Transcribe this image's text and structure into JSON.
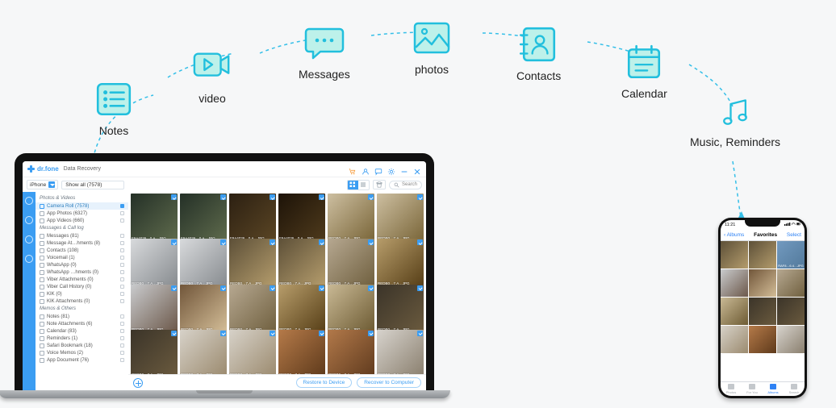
{
  "arc": {
    "notes": {
      "label": "Notes"
    },
    "video": {
      "label": "video"
    },
    "messages": {
      "label": "Messages"
    },
    "photos": {
      "label": "photos"
    },
    "contacts": {
      "label": "Contacts"
    },
    "calendar": {
      "label": "Calendar"
    },
    "music": {
      "label": "Music, Reminders"
    }
  },
  "app": {
    "brand": "dr.fone",
    "breadcrumb": "Data Recovery",
    "device": "iPhone",
    "filter": "Show all (7578)",
    "search_placeholder": "Search",
    "footer": {
      "restore": "Restore to Device",
      "recover": "Recover to Computer"
    }
  },
  "sidebar": {
    "sections": [
      {
        "title": "Photos & Videos",
        "items": [
          {
            "label": "Camera Roll (7578)",
            "active": true
          },
          {
            "label": "App Photos (6327)"
          },
          {
            "label": "App Videos (660)"
          }
        ]
      },
      {
        "title": "Messages & Call log",
        "items": [
          {
            "label": "Messages (81)"
          },
          {
            "label": "Message At…hments (8)"
          },
          {
            "label": "Contacts (108)"
          },
          {
            "label": "Voicemail (1)"
          },
          {
            "label": "WhatsApp (0)"
          },
          {
            "label": "WhatsApp …hments (0)"
          },
          {
            "label": "Viber Attachments (0)"
          },
          {
            "label": "Viber Call History (0)"
          },
          {
            "label": "KIK (0)"
          },
          {
            "label": "KIK Attachments (0)"
          }
        ]
      },
      {
        "title": "Memos & Others",
        "items": [
          {
            "label": "Notes (81)"
          },
          {
            "label": "Note Attachments (6)"
          },
          {
            "label": "Calendar (83)"
          },
          {
            "label": "Reminders (1)"
          },
          {
            "label": "Safari Bookmark (18)"
          },
          {
            "label": "Voice Memos (2)"
          },
          {
            "label": "App Document (76)"
          }
        ]
      }
    ]
  },
  "grid": {
    "items": [
      {
        "cap": "F9A4036…0.A…JPG",
        "c": "t1"
      },
      {
        "cap": "F9A4036…0.A…JPG",
        "c": "t1"
      },
      {
        "cap": "F9A4036…0.A…JPG",
        "c": "t2"
      },
      {
        "cap": "F9A4036…0.A…JPG",
        "c": "t3"
      },
      {
        "cap": "REDB0…7.A…JPG",
        "c": "t4"
      },
      {
        "cap": "REDB0…7.A…JPG",
        "c": "t4"
      },
      {
        "cap": "REDB0…7.A…JPG",
        "c": "t5"
      },
      {
        "cap": "REDB0…7.A…JPG",
        "c": "t5"
      },
      {
        "cap": "REDB0…7.A…JPG",
        "c": "t6"
      },
      {
        "cap": "REDB0…7.A…JPG",
        "c": "t6"
      },
      {
        "cap": "REDB0…7.A…JPG",
        "c": "t7"
      },
      {
        "cap": "REDB0…7.A…JPG",
        "c": "t8"
      },
      {
        "cap": "REDB0…7.A…JPG",
        "c": "t9"
      },
      {
        "cap": "REDB0…7.A…JPG",
        "c": "t10"
      },
      {
        "cap": "REDB0…7.A…JPG",
        "c": "t7"
      },
      {
        "cap": "REDB0…7.A…JPG",
        "c": "t8"
      },
      {
        "cap": "REDB0…7.A…JPG",
        "c": "t16"
      },
      {
        "cap": "REDB0…7.A…JPG",
        "c": "t11"
      },
      {
        "cap": "REDB0…7.A…JPG",
        "c": "t11"
      },
      {
        "cap": "REDB0…7.A…JPG",
        "c": "t12"
      },
      {
        "cap": "REDB0…7.A…JPG",
        "c": "t12"
      },
      {
        "cap": "REDB0…7.A…JPG",
        "c": "t13"
      },
      {
        "cap": "REDB0…7.A…JPG",
        "c": "t14"
      },
      {
        "cap": "REDB0…7.A…JPG",
        "c": "t15"
      }
    ]
  },
  "phone": {
    "time": "11:21",
    "back": "Albums",
    "title": "Favorites",
    "select": "Select",
    "sel_caption": "RAF8…6.4…JPG",
    "tabs": [
      {
        "label": "Photos"
      },
      {
        "label": "For You"
      },
      {
        "label": "Albums",
        "active": true
      },
      {
        "label": "Search"
      }
    ],
    "grid": [
      {
        "c": "t6"
      },
      {
        "c": "t6"
      },
      {
        "c": "t7",
        "sel": true
      },
      {
        "c": "t9"
      },
      {
        "c": "t10"
      },
      {
        "c": "t7"
      },
      {
        "c": "t16"
      },
      {
        "c": "t11"
      },
      {
        "c": "t11"
      },
      {
        "c": "t12"
      },
      {
        "c": "t13"
      },
      {
        "c": "t15"
      }
    ]
  }
}
